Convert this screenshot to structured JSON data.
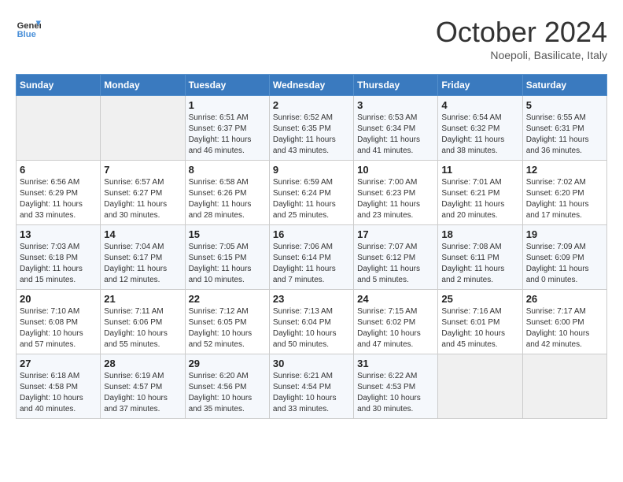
{
  "header": {
    "logo_line1": "General",
    "logo_line2": "Blue",
    "month": "October 2024",
    "location": "Noepoli, Basilicate, Italy"
  },
  "days_of_week": [
    "Sunday",
    "Monday",
    "Tuesday",
    "Wednesday",
    "Thursday",
    "Friday",
    "Saturday"
  ],
  "weeks": [
    [
      {
        "day": "",
        "sunrise": "",
        "sunset": "",
        "daylight": ""
      },
      {
        "day": "",
        "sunrise": "",
        "sunset": "",
        "daylight": ""
      },
      {
        "day": "1",
        "sunrise": "Sunrise: 6:51 AM",
        "sunset": "Sunset: 6:37 PM",
        "daylight": "Daylight: 11 hours and 46 minutes."
      },
      {
        "day": "2",
        "sunrise": "Sunrise: 6:52 AM",
        "sunset": "Sunset: 6:35 PM",
        "daylight": "Daylight: 11 hours and 43 minutes."
      },
      {
        "day": "3",
        "sunrise": "Sunrise: 6:53 AM",
        "sunset": "Sunset: 6:34 PM",
        "daylight": "Daylight: 11 hours and 41 minutes."
      },
      {
        "day": "4",
        "sunrise": "Sunrise: 6:54 AM",
        "sunset": "Sunset: 6:32 PM",
        "daylight": "Daylight: 11 hours and 38 minutes."
      },
      {
        "day": "5",
        "sunrise": "Sunrise: 6:55 AM",
        "sunset": "Sunset: 6:31 PM",
        "daylight": "Daylight: 11 hours and 36 minutes."
      }
    ],
    [
      {
        "day": "6",
        "sunrise": "Sunrise: 6:56 AM",
        "sunset": "Sunset: 6:29 PM",
        "daylight": "Daylight: 11 hours and 33 minutes."
      },
      {
        "day": "7",
        "sunrise": "Sunrise: 6:57 AM",
        "sunset": "Sunset: 6:27 PM",
        "daylight": "Daylight: 11 hours and 30 minutes."
      },
      {
        "day": "8",
        "sunrise": "Sunrise: 6:58 AM",
        "sunset": "Sunset: 6:26 PM",
        "daylight": "Daylight: 11 hours and 28 minutes."
      },
      {
        "day": "9",
        "sunrise": "Sunrise: 6:59 AM",
        "sunset": "Sunset: 6:24 PM",
        "daylight": "Daylight: 11 hours and 25 minutes."
      },
      {
        "day": "10",
        "sunrise": "Sunrise: 7:00 AM",
        "sunset": "Sunset: 6:23 PM",
        "daylight": "Daylight: 11 hours and 23 minutes."
      },
      {
        "day": "11",
        "sunrise": "Sunrise: 7:01 AM",
        "sunset": "Sunset: 6:21 PM",
        "daylight": "Daylight: 11 hours and 20 minutes."
      },
      {
        "day": "12",
        "sunrise": "Sunrise: 7:02 AM",
        "sunset": "Sunset: 6:20 PM",
        "daylight": "Daylight: 11 hours and 17 minutes."
      }
    ],
    [
      {
        "day": "13",
        "sunrise": "Sunrise: 7:03 AM",
        "sunset": "Sunset: 6:18 PM",
        "daylight": "Daylight: 11 hours and 15 minutes."
      },
      {
        "day": "14",
        "sunrise": "Sunrise: 7:04 AM",
        "sunset": "Sunset: 6:17 PM",
        "daylight": "Daylight: 11 hours and 12 minutes."
      },
      {
        "day": "15",
        "sunrise": "Sunrise: 7:05 AM",
        "sunset": "Sunset: 6:15 PM",
        "daylight": "Daylight: 11 hours and 10 minutes."
      },
      {
        "day": "16",
        "sunrise": "Sunrise: 7:06 AM",
        "sunset": "Sunset: 6:14 PM",
        "daylight": "Daylight: 11 hours and 7 minutes."
      },
      {
        "day": "17",
        "sunrise": "Sunrise: 7:07 AM",
        "sunset": "Sunset: 6:12 PM",
        "daylight": "Daylight: 11 hours and 5 minutes."
      },
      {
        "day": "18",
        "sunrise": "Sunrise: 7:08 AM",
        "sunset": "Sunset: 6:11 PM",
        "daylight": "Daylight: 11 hours and 2 minutes."
      },
      {
        "day": "19",
        "sunrise": "Sunrise: 7:09 AM",
        "sunset": "Sunset: 6:09 PM",
        "daylight": "Daylight: 11 hours and 0 minutes."
      }
    ],
    [
      {
        "day": "20",
        "sunrise": "Sunrise: 7:10 AM",
        "sunset": "Sunset: 6:08 PM",
        "daylight": "Daylight: 10 hours and 57 minutes."
      },
      {
        "day": "21",
        "sunrise": "Sunrise: 7:11 AM",
        "sunset": "Sunset: 6:06 PM",
        "daylight": "Daylight: 10 hours and 55 minutes."
      },
      {
        "day": "22",
        "sunrise": "Sunrise: 7:12 AM",
        "sunset": "Sunset: 6:05 PM",
        "daylight": "Daylight: 10 hours and 52 minutes."
      },
      {
        "day": "23",
        "sunrise": "Sunrise: 7:13 AM",
        "sunset": "Sunset: 6:04 PM",
        "daylight": "Daylight: 10 hours and 50 minutes."
      },
      {
        "day": "24",
        "sunrise": "Sunrise: 7:15 AM",
        "sunset": "Sunset: 6:02 PM",
        "daylight": "Daylight: 10 hours and 47 minutes."
      },
      {
        "day": "25",
        "sunrise": "Sunrise: 7:16 AM",
        "sunset": "Sunset: 6:01 PM",
        "daylight": "Daylight: 10 hours and 45 minutes."
      },
      {
        "day": "26",
        "sunrise": "Sunrise: 7:17 AM",
        "sunset": "Sunset: 6:00 PM",
        "daylight": "Daylight: 10 hours and 42 minutes."
      }
    ],
    [
      {
        "day": "27",
        "sunrise": "Sunrise: 6:18 AM",
        "sunset": "Sunset: 4:58 PM",
        "daylight": "Daylight: 10 hours and 40 minutes."
      },
      {
        "day": "28",
        "sunrise": "Sunrise: 6:19 AM",
        "sunset": "Sunset: 4:57 PM",
        "daylight": "Daylight: 10 hours and 37 minutes."
      },
      {
        "day": "29",
        "sunrise": "Sunrise: 6:20 AM",
        "sunset": "Sunset: 4:56 PM",
        "daylight": "Daylight: 10 hours and 35 minutes."
      },
      {
        "day": "30",
        "sunrise": "Sunrise: 6:21 AM",
        "sunset": "Sunset: 4:54 PM",
        "daylight": "Daylight: 10 hours and 33 minutes."
      },
      {
        "day": "31",
        "sunrise": "Sunrise: 6:22 AM",
        "sunset": "Sunset: 4:53 PM",
        "daylight": "Daylight: 10 hours and 30 minutes."
      },
      {
        "day": "",
        "sunrise": "",
        "sunset": "",
        "daylight": ""
      },
      {
        "day": "",
        "sunrise": "",
        "sunset": "",
        "daylight": ""
      }
    ]
  ]
}
